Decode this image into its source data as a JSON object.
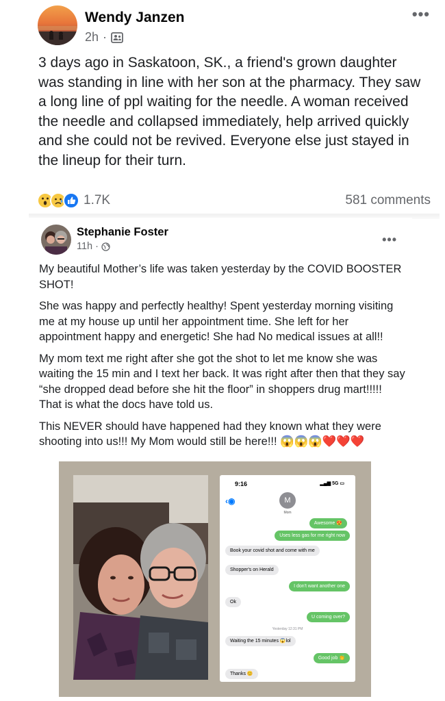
{
  "post": {
    "author": "Wendy Janzen",
    "time": "2h",
    "audience_icon": "friends-icon",
    "body": "3 days ago in Saskatoon, SK., a friend's grown daughter was standing in line with her son at the pharmacy. They saw a long line of ppl waiting for the needle. A woman received the needle and collapsed immediately, help arrived quickly and she could not be revived. Everyone else just stayed in the lineup for their turn.",
    "reactions": [
      "wow-icon",
      "sad-icon",
      "like-icon"
    ],
    "reaction_count": "1.7K",
    "comments": "581 comments"
  },
  "shared": {
    "author": "Stephanie Foster",
    "time": "11h",
    "audience_icon": "globe-icon",
    "paragraphs": [
      "My beautiful Mother’s life was taken yesterday by the COVID BOOSTER SHOT!",
      "She was happy and perfectly healthy! Spent yesterday morning visiting me at my house up until her appointment time. She left for her appointment happy and energetic! She had No medical issues at all!!",
      "My mom text me right after she got the shot to let me know she was waiting the 15 min and I text her back. It was right after then that they say “she dropped dead before she hit the floor” in shoppers drug mart!!!!! That is what the docs have told us.",
      "This NEVER should have happened had they known what they were shooting into us!!! My Mom would still be here!!! 😱😱😱❤️❤️❤️"
    ]
  },
  "phone": {
    "time": "9:16",
    "network": "5G",
    "contact_initial": "M",
    "contact_name": "Mom",
    "messages": [
      {
        "from": "me",
        "text": "Awesome 😍"
      },
      {
        "from": "me",
        "text": "Uses less gas for me right now"
      },
      {
        "from": "them",
        "text": "Book your covid shot and come with me"
      },
      {
        "from": "them",
        "text": "Shopper's on Herald"
      },
      {
        "from": "me",
        "text": "I don't want another one"
      },
      {
        "from": "them",
        "text": "Ok"
      },
      {
        "from": "me",
        "text": "U coming over?"
      },
      {
        "from": "stamp",
        "text": "Yesterday 12:31 PM"
      },
      {
        "from": "them",
        "text": "Waiting the 15 minutes 😱lol"
      },
      {
        "from": "me",
        "text": "Good job 👏"
      },
      {
        "from": "them",
        "text": "Thanks 😊"
      }
    ]
  },
  "colors": {
    "secondary_text": "#65676b",
    "imessage_green": "#65c466",
    "imessage_grey": "#e9e9eb",
    "ios_blue": "#007aff"
  }
}
